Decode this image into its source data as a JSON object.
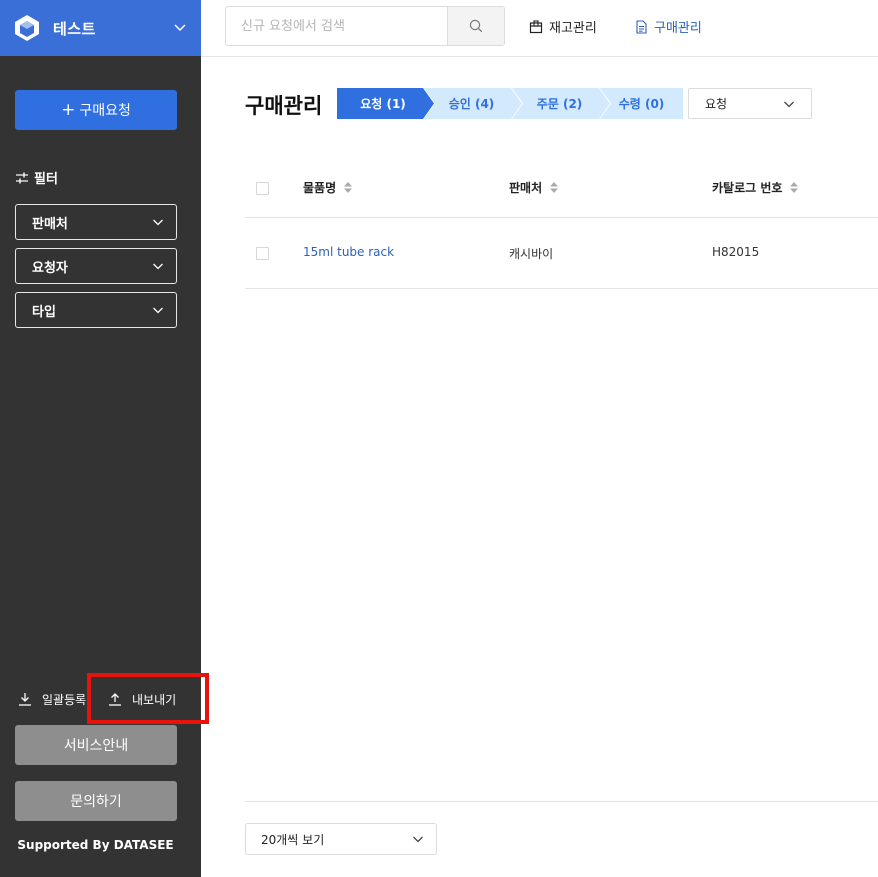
{
  "brand": {
    "name": "테스트"
  },
  "sidebar": {
    "request_button": {
      "icon": "plus-icon",
      "label": "구매요청"
    },
    "filter_title": "필터",
    "filters": [
      {
        "label": "판매처"
      },
      {
        "label": "요청자"
      },
      {
        "label": "타입"
      }
    ],
    "bulk_register": "일괄등록",
    "export": "내보내기",
    "service_guide": "서비스안내",
    "inquiry": "문의하기",
    "supported_by": "Supported By DATASEE"
  },
  "topbar": {
    "search_placeholder": "신규 요청에서 검색",
    "nav": [
      {
        "label": "재고관리",
        "icon": "box-icon"
      },
      {
        "label": "구매관리",
        "icon": "document-icon"
      }
    ]
  },
  "main": {
    "title": "구매관리",
    "steps": [
      {
        "label": "요청 (1)",
        "active": true
      },
      {
        "label": "승인 (4)",
        "active": false
      },
      {
        "label": "주문 (2)",
        "active": false
      },
      {
        "label": "수령 (0)",
        "active": false
      }
    ],
    "status_select": "요청",
    "table": {
      "columns": [
        "물품명",
        "판매처",
        "카탈로그 번호"
      ],
      "rows": [
        [
          "15ml tube rack",
          "캐시바이",
          "H82015"
        ]
      ]
    },
    "page_size": "20개씩 보기"
  },
  "colors": {
    "sidebar_bg": "#333333",
    "brand_bg": "#3a6fd8",
    "primary": "#2f6fe0",
    "step_active": "#2f6fe0",
    "step_inactive": "#d3e9fd",
    "step_inactive_text": "#2f6fe0",
    "link": "#2b62b5",
    "highlight": "#e8130b",
    "gray_button": "#8e8e8e"
  }
}
